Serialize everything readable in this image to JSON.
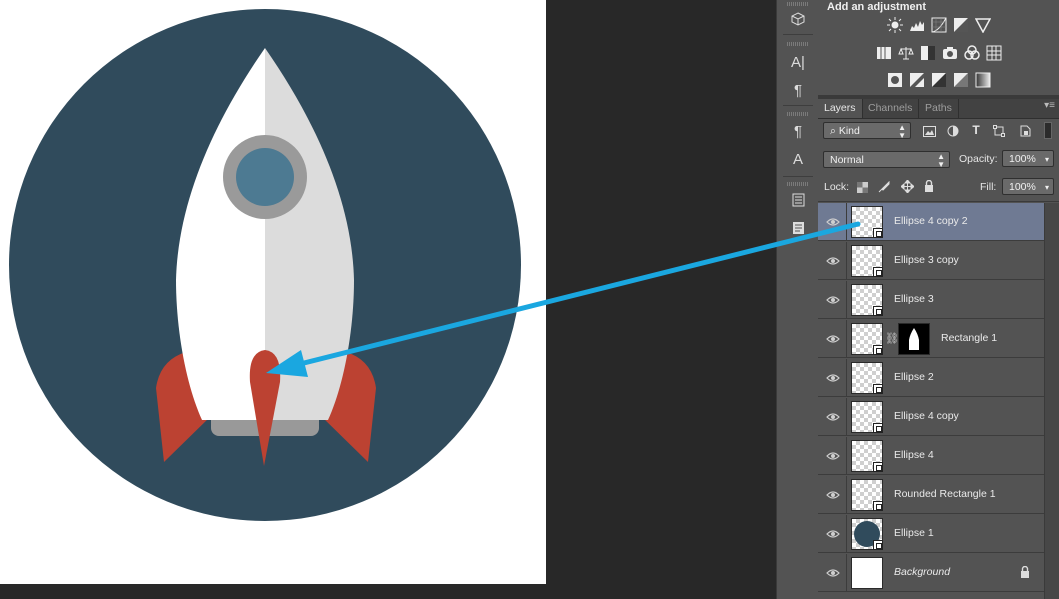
{
  "adjustments": {
    "title": "Add an adjustment",
    "row1": [
      "brightness-icon",
      "levels-icon",
      "curves-icon",
      "exposure-icon",
      "gradient-triangle-icon"
    ],
    "row2": [
      "vibrance-icon",
      "balance-icon",
      "black-white-icon",
      "photo-filter-icon",
      "channel-mixer-icon",
      "color-lookup-icon"
    ],
    "row3": [
      "invert-icon",
      "posterize-icon",
      "threshold-icon",
      "selective-color-icon",
      "gradient-map-icon"
    ]
  },
  "panel": {
    "tabs": [
      {
        "label": "Layers",
        "active": true
      },
      {
        "label": "Channels",
        "active": false
      },
      {
        "label": "Paths",
        "active": false
      }
    ],
    "filter_kind": "Kind",
    "blend_mode": "Normal",
    "opacity_label": "Opacity:",
    "opacity_value": "100%",
    "lock_label": "Lock:",
    "fill_label": "Fill:",
    "fill_value": "100%"
  },
  "layers": [
    {
      "name": "Ellipse 4 copy 2",
      "selected": true,
      "thumb": "transparent"
    },
    {
      "name": "Ellipse 3 copy",
      "selected": false,
      "thumb": "transparent"
    },
    {
      "name": "Ellipse 3",
      "selected": false,
      "thumb": "transparent"
    },
    {
      "name": "Rectangle 1",
      "selected": false,
      "thumb": "transparent",
      "has_mask": true
    },
    {
      "name": "Ellipse 2",
      "selected": false,
      "thumb": "transparent"
    },
    {
      "name": "Ellipse 4 copy",
      "selected": false,
      "thumb": "transparent"
    },
    {
      "name": "Ellipse 4",
      "selected": false,
      "thumb": "transparent"
    },
    {
      "name": "Rounded Rectangle 1",
      "selected": false,
      "thumb": "transparent"
    },
    {
      "name": "Ellipse 1",
      "selected": false,
      "thumb": "dark-circle"
    },
    {
      "name": "Background",
      "selected": false,
      "thumb": "white",
      "italic": true,
      "locked": true
    }
  ],
  "colors": {
    "circle": "#304b5c",
    "rocket_light": "#ffffff",
    "rocket_shade": "#dcdcdc",
    "window_ring": "#9a9a9a",
    "window": "#4d7a92",
    "fins": "#bc4232",
    "nozzle": "#999999",
    "annotation_arrow": "#1aa7e0",
    "selected_layer": "#6f7a93"
  }
}
